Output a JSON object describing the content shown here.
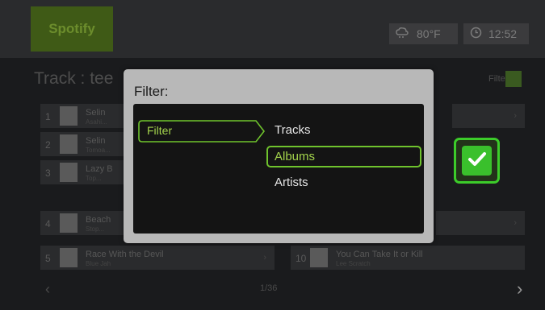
{
  "topbar": {
    "logo": "Spotify",
    "temperature": "80°F",
    "time": "12:52"
  },
  "list": {
    "title": "Track : tee",
    "filter_tag": "Filter",
    "left_rows": [
      {
        "num": "1",
        "title": "Selin",
        "sub": "Asahi..."
      },
      {
        "num": "2",
        "title": "Selin",
        "sub": "Tomoa..."
      },
      {
        "num": "3",
        "title": "Lazy B",
        "sub": "Top..."
      },
      {
        "num": "4",
        "title": "Beach",
        "sub": "Stop..."
      },
      {
        "num": "5",
        "title": "Race With the Devil",
        "sub": "Blue Jah"
      }
    ],
    "right_rows": [
      {
        "num": "10",
        "title": "You Can Take It or Kill",
        "sub": "Lee Scratch"
      }
    ],
    "page": "1/36"
  },
  "dialog": {
    "title": "Filter:",
    "filter_label": "Filter",
    "options": [
      "Tracks",
      "Albums",
      "Artists"
    ],
    "selected": "Albums"
  },
  "icons": {
    "weather": "snow-cloud-icon",
    "clock": "clock-icon",
    "ok": "checkmark-icon"
  },
  "colors": {
    "accent": "#6fc32d",
    "ok_green": "#3ac02c",
    "dialog_bg": "#b8b8b8",
    "panel_bg": "#141414"
  }
}
